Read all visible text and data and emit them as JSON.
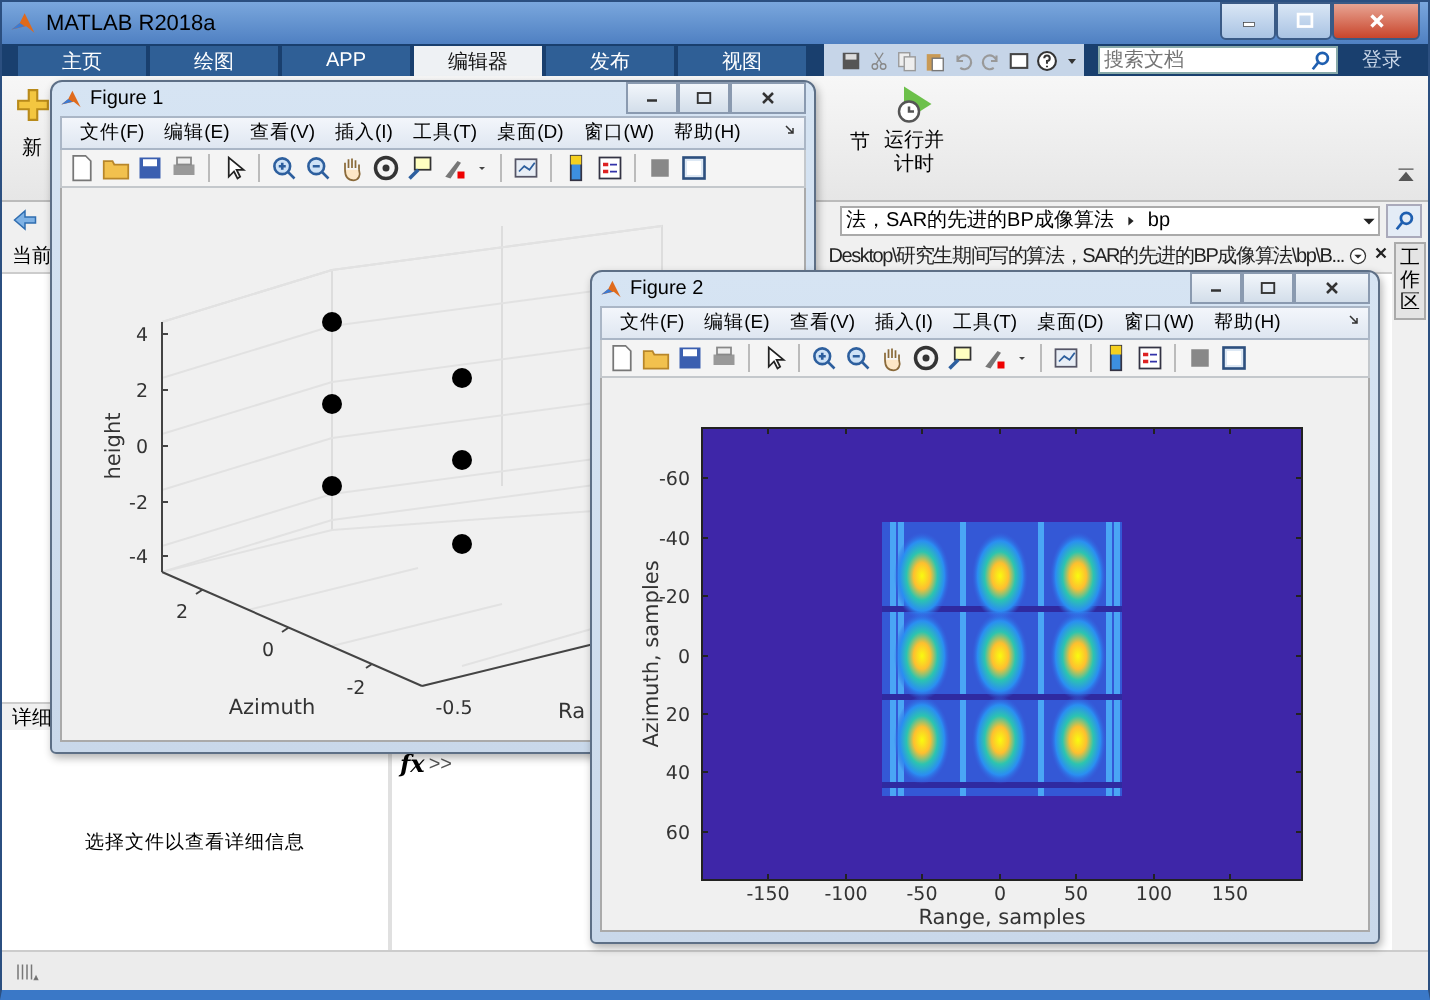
{
  "window": {
    "title": "MATLAB R2018a"
  },
  "tabs": [
    {
      "label": "主页",
      "selected": false
    },
    {
      "label": "绘图",
      "selected": false
    },
    {
      "label": "APP",
      "selected": false
    },
    {
      "label": "编辑器",
      "selected": true
    },
    {
      "label": "发布",
      "selected": false
    },
    {
      "label": "视图",
      "selected": false
    }
  ],
  "search": {
    "placeholder": "搜索文档"
  },
  "sign_in": "登录",
  "ribbon": {
    "new_button": "新",
    "section_text": "节",
    "run_time_button": "运行并计时"
  },
  "address_bar": {
    "path": "法，SAR的先进的BP成像算法",
    "current": "bp"
  },
  "current_folder": {
    "title": "当前",
    "path": "Desktop\\研究生期间写的算法，SAR的先进的BP成像算法\\bp\\B..."
  },
  "details": {
    "title": "详细",
    "message": "选择文件以查看详细信息"
  },
  "command_window": {
    "fx": "fx",
    "prompt": ">>"
  },
  "side_tab": "工作区",
  "figures": [
    {
      "title": "Figure 1",
      "menu": [
        "文件(F)",
        "编辑(E)",
        "查看(V)",
        "插入(I)",
        "工具(T)",
        "桌面(D)",
        "窗口(W)",
        "帮助(H)"
      ],
      "plot": {
        "kind": "scatter3d",
        "zlabel": "height",
        "zticks": [
          "4",
          "2",
          "0",
          "-2",
          "-4"
        ],
        "ylabel": "Azimuth",
        "yticks": [
          "2",
          "0",
          "-2"
        ],
        "xlabel": "Ra",
        "xticks": [
          "-0.5"
        ]
      }
    },
    {
      "title": "Figure 2",
      "menu": [
        "文件(F)",
        "编辑(E)",
        "查看(V)",
        "插入(I)",
        "工具(T)",
        "桌面(D)",
        "窗口(W)",
        "帮助(H)"
      ],
      "plot": {
        "kind": "image",
        "ylabel": "Azimuth, samples",
        "yticks": [
          "-60",
          "-40",
          "-20",
          "0",
          "20",
          "40",
          "60"
        ],
        "xlabel": "Range, samples",
        "xticks": [
          "-150",
          "-100",
          "-50",
          "0",
          "50",
          "100",
          "150"
        ]
      }
    }
  ]
}
